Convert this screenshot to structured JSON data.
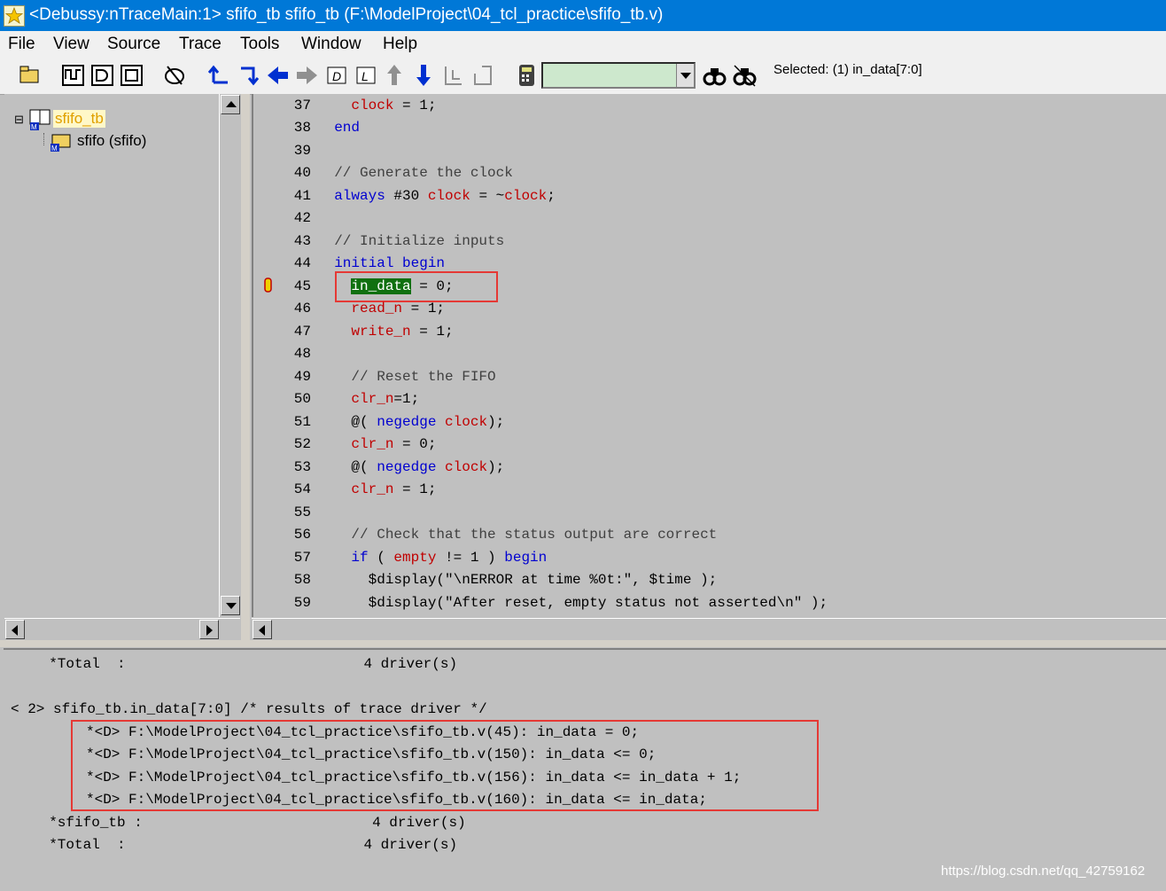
{
  "window": {
    "title": "<Debussy:nTraceMain:1> sfifo_tb sfifo_tb (F:\\ModelProject\\04_tcl_practice\\sfifo_tb.v)"
  },
  "menu": [
    "File",
    "View",
    "Source",
    "Trace",
    "Tools",
    "Window",
    "Help"
  ],
  "toolbar": {
    "icons": [
      "open-file-icon",
      "waveform-icon",
      "schematic-icon",
      "state-machine-icon",
      "trace-icon",
      "trace-up-icon",
      "trace-down-icon",
      "back-icon",
      "forward-icon",
      "driver-icon",
      "load-icon",
      "up-arrow-icon",
      "down-arrow-icon",
      "expand-icon",
      "collapse-icon",
      "calculator-icon",
      "find-icon",
      "find-next-icon"
    ],
    "search_value": "",
    "selected_text": "Selected: (1) in_data[7:0]"
  },
  "hierarchy": {
    "root": "sfifo_tb",
    "child": "sfifo (sfifo)"
  },
  "source": {
    "lines": [
      {
        "num": "37",
        "code": "    clock = 1;"
      },
      {
        "num": "38",
        "code": "  end"
      },
      {
        "num": "39",
        "code": ""
      },
      {
        "num": "40",
        "code": "  // Generate the clock"
      },
      {
        "num": "41",
        "code": "  always #30 clock = ~clock;"
      },
      {
        "num": "42",
        "code": ""
      },
      {
        "num": "43",
        "code": "  // Initialize inputs"
      },
      {
        "num": "44",
        "code": "  initial begin"
      },
      {
        "num": "45",
        "code": "    in_data = 0;"
      },
      {
        "num": "46",
        "code": "    read_n = 1;"
      },
      {
        "num": "47",
        "code": "    write_n = 1;"
      },
      {
        "num": "48",
        "code": ""
      },
      {
        "num": "49",
        "code": "    // Reset the FIFO"
      },
      {
        "num": "50",
        "code": "    clr_n=1;"
      },
      {
        "num": "51",
        "code": "    @( negedge clock);"
      },
      {
        "num": "52",
        "code": "    clr_n = 0;"
      },
      {
        "num": "53",
        "code": "    @( negedge clock);"
      },
      {
        "num": "54",
        "code": "    clr_n = 1;"
      },
      {
        "num": "55",
        "code": ""
      },
      {
        "num": "56",
        "code": "    // Check that the status output are correct"
      },
      {
        "num": "57",
        "code": "    if ( empty != 1 ) begin"
      },
      {
        "num": "58",
        "code": "      $display(\"\\nERROR at time %0t:\", $time );"
      },
      {
        "num": "59",
        "code": "      $display(\"After reset, empty status not asserted\\n\" );"
      }
    ]
  },
  "messages": {
    "total1": "  *Total  :                            4 driver(s)",
    "prompt": "< 2> sfifo_tb.in_data[7:0] /* results of trace driver */",
    "drivers": [
      "*<D> F:\\ModelProject\\04_tcl_practice\\sfifo_tb.v(45): in_data = 0;",
      "*<D> F:\\ModelProject\\04_tcl_practice\\sfifo_tb.v(150): in_data <= 0;",
      "*<D> F:\\ModelProject\\04_tcl_practice\\sfifo_tb.v(156): in_data <= in_data + 1;",
      "*<D> F:\\ModelProject\\04_tcl_practice\\sfifo_tb.v(160): in_data <= in_data;"
    ],
    "sfifo_tb": "  *sfifo_tb :                           4 driver(s)",
    "total2": "  *Total  :                            4 driver(s)"
  },
  "watermark": "https://blog.csdn.net/qq_42759162"
}
